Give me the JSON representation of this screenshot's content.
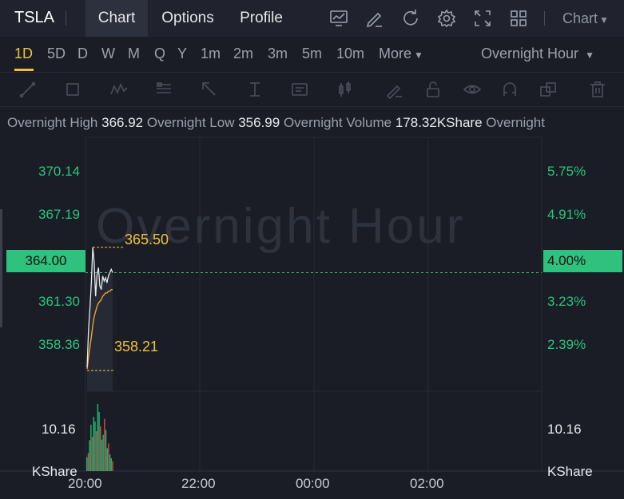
{
  "header": {
    "ticker": "TSLA",
    "tabs": [
      {
        "label": "Chart",
        "active": true
      },
      {
        "label": "Options",
        "active": false
      },
      {
        "label": "Profile",
        "active": false
      }
    ],
    "icons": [
      "indicator-chart-icon",
      "pencil-icon",
      "refresh-icon",
      "settings-gear-icon",
      "fullscreen-expand-icon",
      "grid-layout-icon"
    ],
    "chart_type_label": "Chart"
  },
  "periods": {
    "items": [
      "1D",
      "5D",
      "D",
      "W",
      "M",
      "Q",
      "Y",
      "1m",
      "2m",
      "3m",
      "5m",
      "10m"
    ],
    "active": "1D",
    "more_label": "More",
    "session_label": "Overnight Hour"
  },
  "drawing_tools": [
    "trend-line-icon",
    "rectangle-icon",
    "pattern-icon",
    "fibonacci-icon",
    "arrow-icon",
    "measure-icon",
    "text-note-icon",
    "candle-icon",
    "pen-icon",
    "lock-icon",
    "eye-icon",
    "magnet-icon",
    "copy-icon",
    "trash-icon"
  ],
  "info": {
    "high_label": "Overnight High",
    "high_value": "366.92",
    "low_label": "Overnight Low",
    "low_value": "356.99",
    "volume_label": "Overnight Volume",
    "volume_value": "178.32KShare",
    "extra_label": "Overnight"
  },
  "chart": {
    "watermark": "Overnight Hour",
    "price_axis": [
      "370.14",
      "367.19",
      "361.30",
      "358.36"
    ],
    "pct_axis": [
      "5.75%",
      "4.91%",
      "3.23%",
      "2.39%"
    ],
    "current_price_tag": "364.00",
    "current_pct_tag": "4.00%",
    "high_marker": "365.50",
    "low_marker": "358.21",
    "volume_tick": "10.16",
    "volume_unit": "KShare",
    "time_axis": [
      "20:00",
      "22:00",
      "00:00",
      "02:00"
    ],
    "colors": {
      "up": "#29c47c",
      "down": "#e5534b",
      "accent": "#f0c33c",
      "line": "#e8eaee",
      "avg": "#f0a030"
    }
  },
  "chart_data": {
    "type": "line",
    "x": [
      "20:00",
      "20:01",
      "20:02",
      "20:03",
      "20:04",
      "20:05",
      "20:06",
      "20:07",
      "20:08",
      "20:09",
      "20:10",
      "20:12",
      "20:14",
      "20:16",
      "20:18",
      "20:20",
      "20:22",
      "20:24",
      "20:26"
    ],
    "series": [
      {
        "values": [
          358.4,
          360.6,
          361.9,
          363.4,
          365.5,
          364.6,
          362.6,
          363.9,
          364.3,
          363.2,
          363.0,
          363.8,
          363.5,
          363.7,
          363.4,
          363.8,
          364.0,
          364.2,
          364.0
        ]
      },
      {
        "values": [
          358.3,
          359.0,
          359.6,
          360.2,
          360.9,
          361.4,
          361.7,
          362.0,
          362.2,
          362.3,
          362.4,
          362.6,
          362.7,
          362.8,
          362.8,
          362.9,
          362.9,
          363.0,
          363.0
        ]
      }
    ],
    "volume": [
      2.6,
      3.4,
      5.8,
      8.7,
      6.4,
      10.2,
      9.3,
      7.5,
      12.6,
      11.1,
      8.4,
      5.9,
      6.8,
      9.8,
      7.7,
      4.3,
      5.2,
      3.1,
      2.4,
      1.8
    ],
    "ylim": [
      356.99,
      372.0
    ],
    "y_ticks": [
      370.14,
      367.19,
      364.0,
      361.3,
      358.36
    ],
    "current_price": 364.0,
    "high": 365.5,
    "low": 358.21,
    "volume_ylim": [
      0,
      15
    ]
  }
}
